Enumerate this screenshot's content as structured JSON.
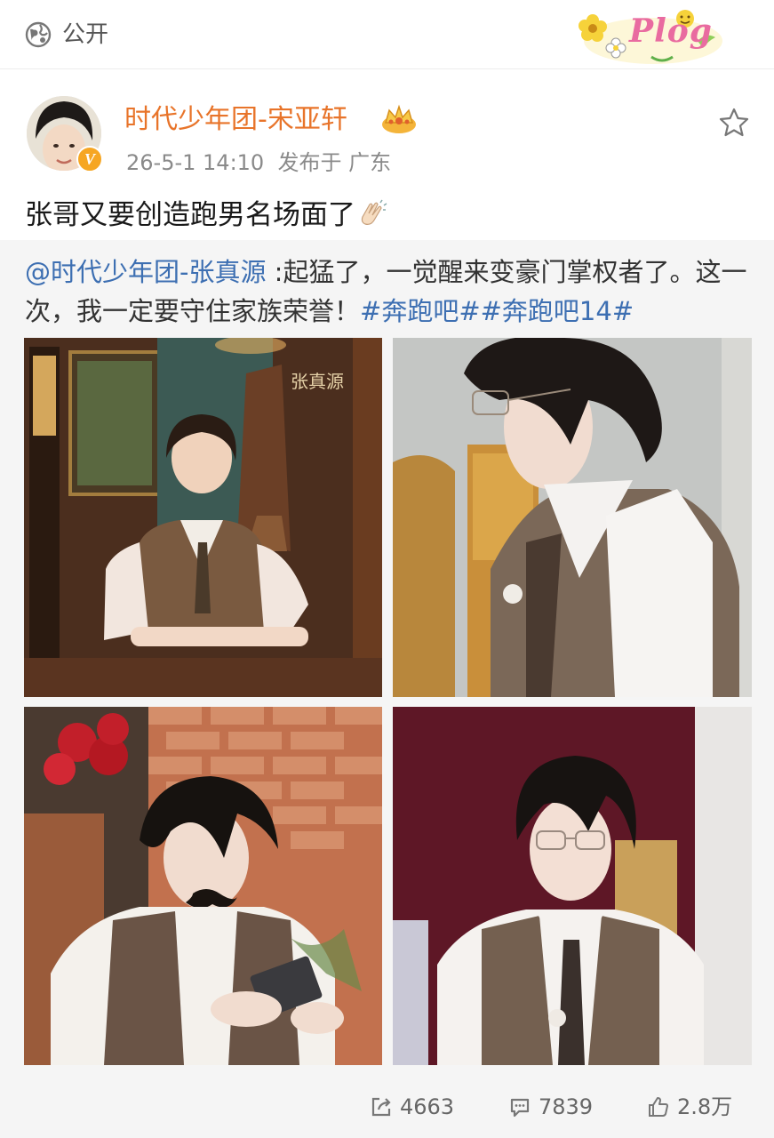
{
  "topbar": {
    "visibility": "公开",
    "badge_text": "Plog"
  },
  "post": {
    "author": "时代少年团-宋亚轩",
    "timestamp": "26-5-1 14:10",
    "location": "发布于 广东",
    "text": "张哥又要创造跑男名场面了"
  },
  "repost": {
    "mention": "@时代少年团-张真源",
    "body": " :起猛了，一觉醒来变豪门掌权者了。这一次，我一定要守住家族荣誉！",
    "hashtags": [
      "#奔跑吧#",
      "#奔跑吧14#"
    ],
    "poster_text": "张真源"
  },
  "actions": {
    "reposts": "4663",
    "comments": "7839",
    "likes": "2.8万"
  },
  "colors": {
    "author": "#e8742a",
    "link": "#3d6fb2",
    "repost_bg": "#f5f5f5"
  },
  "icons": [
    "globe-icon",
    "crown-icon",
    "star-icon",
    "clap-icon",
    "repost-icon",
    "comment-icon",
    "like-icon",
    "verified-icon"
  ]
}
